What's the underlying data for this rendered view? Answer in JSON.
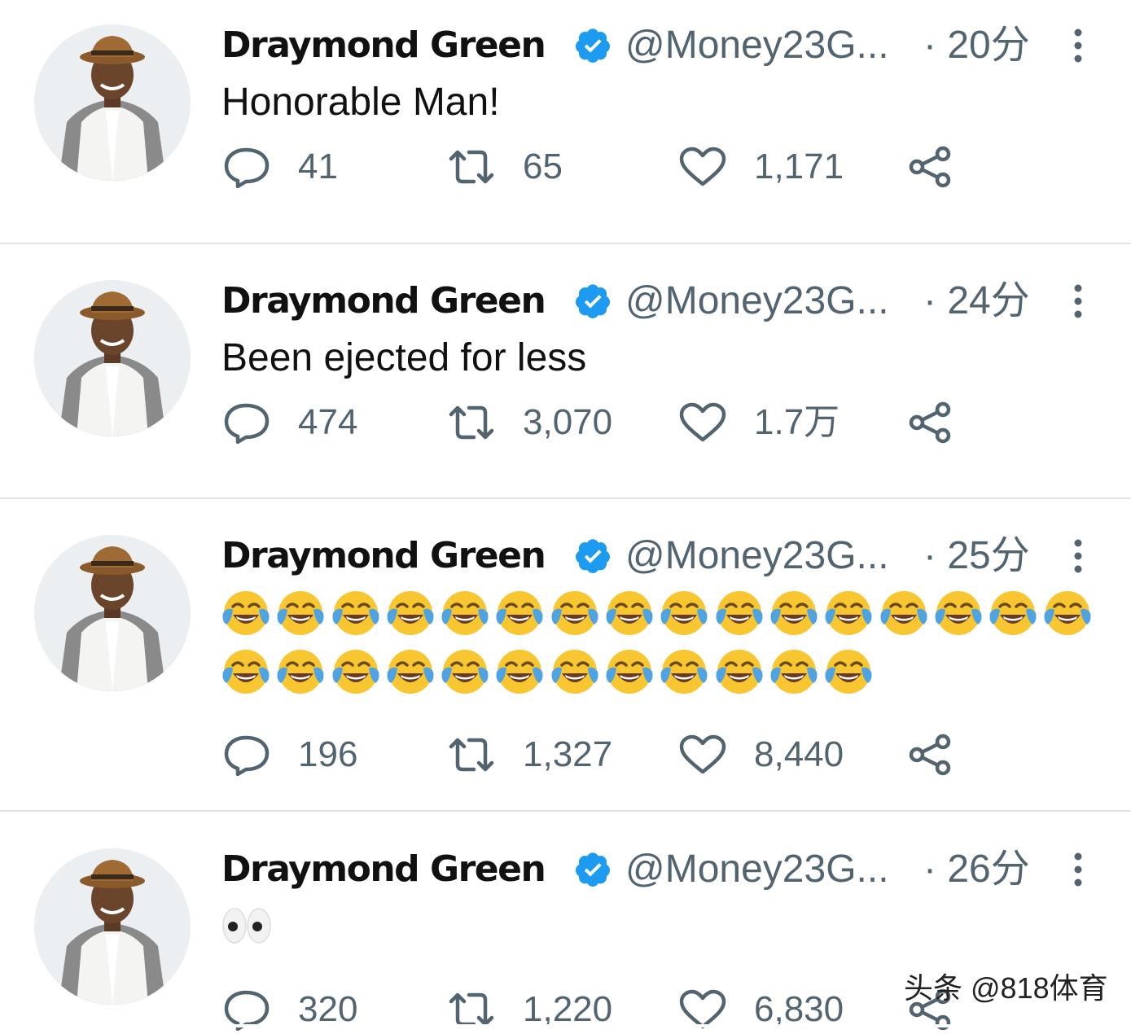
{
  "colors": {
    "text": "#0f1419",
    "secondary": "#536471",
    "verified": "#1d9bf0",
    "separator": "#e1e4e6"
  },
  "tweets": [
    {
      "name": "Draymond Green",
      "handle": "@Money23G...",
      "time": "· 20分",
      "text": "Honorable Man!",
      "replies": "41",
      "retweets": "65",
      "likes": "1,171"
    },
    {
      "name": "Draymond Green",
      "handle": "@Money23G...",
      "time": "· 24分",
      "text": "Been ejected for less",
      "replies": "474",
      "retweets": "3,070",
      "likes": "1.7万"
    },
    {
      "name": "Draymond Green",
      "handle": "@Money23G...",
      "time": "· 25分",
      "emoji": "face-with-tears-of-joy",
      "emoji_count": 28,
      "replies": "196",
      "retweets": "1,327",
      "likes": "8,440"
    },
    {
      "name": "Draymond Green",
      "handle": "@Money23G...",
      "time": "· 26分",
      "emoji": "eyes",
      "replies": "320",
      "retweets": "1,220",
      "likes": "6,830"
    }
  ],
  "watermark": "头条 @818体育",
  "icons": {
    "reply": "speech-bubble-icon",
    "retweet": "retweet-icon",
    "like": "heart-icon",
    "share": "share-icon",
    "more": "vertical-dots-icon",
    "verified": "verified-badge-icon"
  }
}
